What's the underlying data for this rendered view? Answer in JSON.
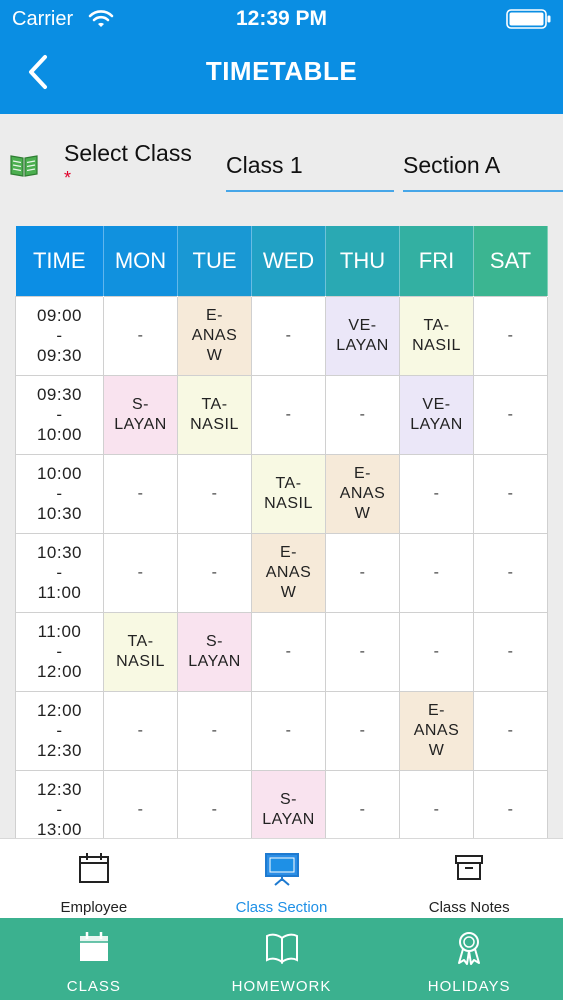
{
  "status_bar": {
    "carrier": "Carrier",
    "time": "12:39 PM"
  },
  "header": {
    "title": "TIMETABLE"
  },
  "select_class": {
    "label": "Select Class",
    "required_mark": "*",
    "class_value": "Class 1",
    "section_value": "Section A"
  },
  "timetable": {
    "headers": [
      "TIME",
      "MON",
      "TUE",
      "WED",
      "THU",
      "FRI",
      "SAT"
    ],
    "header_colors": [
      "#0c8ee4",
      "#1191de",
      "#1998d4",
      "#21a1c5",
      "#2aa9b3",
      "#33b0a2",
      "#3bb591"
    ],
    "rows": [
      {
        "time": [
          "09:00",
          "-",
          "09:30"
        ],
        "cells": [
          "-",
          "E-\nANAS\nW",
          "-",
          "VE-\nLAYAN",
          "TA-\nNASIL",
          "-"
        ]
      },
      {
        "time": [
          "09:30",
          "-",
          "10:00"
        ],
        "cells": [
          "S-\nLAYAN",
          "TA-\nNASIL",
          "-",
          "-",
          "VE-\nLAYAN",
          "-"
        ]
      },
      {
        "time": [
          "10:00",
          "-",
          "10:30"
        ],
        "cells": [
          "-",
          "-",
          "TA-\nNASIL",
          "E-\nANAS\nW",
          "-",
          "-"
        ]
      },
      {
        "time": [
          "10:30",
          "-",
          "11:00"
        ],
        "cells": [
          "-",
          "-",
          "E-\nANAS\nW",
          "-",
          "-",
          "-"
        ]
      },
      {
        "time": [
          "11:00",
          "-",
          "12:00"
        ],
        "cells": [
          "TA-\nNASIL",
          "S-\nLAYAN",
          "-",
          "-",
          "-",
          "-"
        ]
      },
      {
        "time": [
          "12:00",
          "-",
          "12:30"
        ],
        "cells": [
          "-",
          "-",
          "-",
          "-",
          "E-\nANAS\nW",
          "-"
        ]
      },
      {
        "time": [
          "12:30",
          "-",
          "13:00"
        ],
        "cells": [
          "-",
          "-",
          "S-\nLAYAN",
          "-",
          "-",
          "-"
        ]
      }
    ]
  },
  "subtabs": [
    {
      "label": "Employee",
      "icon": "calendar-icon",
      "active": false
    },
    {
      "label": "Class Section",
      "icon": "whiteboard-icon",
      "active": true
    },
    {
      "label": "Class Notes",
      "icon": "archive-box-icon",
      "active": false
    }
  ],
  "bottom_tabs": [
    {
      "label": "CLASS",
      "icon": "calendar-icon"
    },
    {
      "label": "HOMEWORK",
      "icon": "book-open-icon"
    },
    {
      "label": "HOLIDAYS",
      "icon": "ribbon-badge-icon"
    }
  ],
  "colors": {
    "header_blue": "#0a8ee3",
    "accent_blue": "#1e90e6",
    "bottom_green": "#3bb18f",
    "required_red": "#e0002a"
  }
}
